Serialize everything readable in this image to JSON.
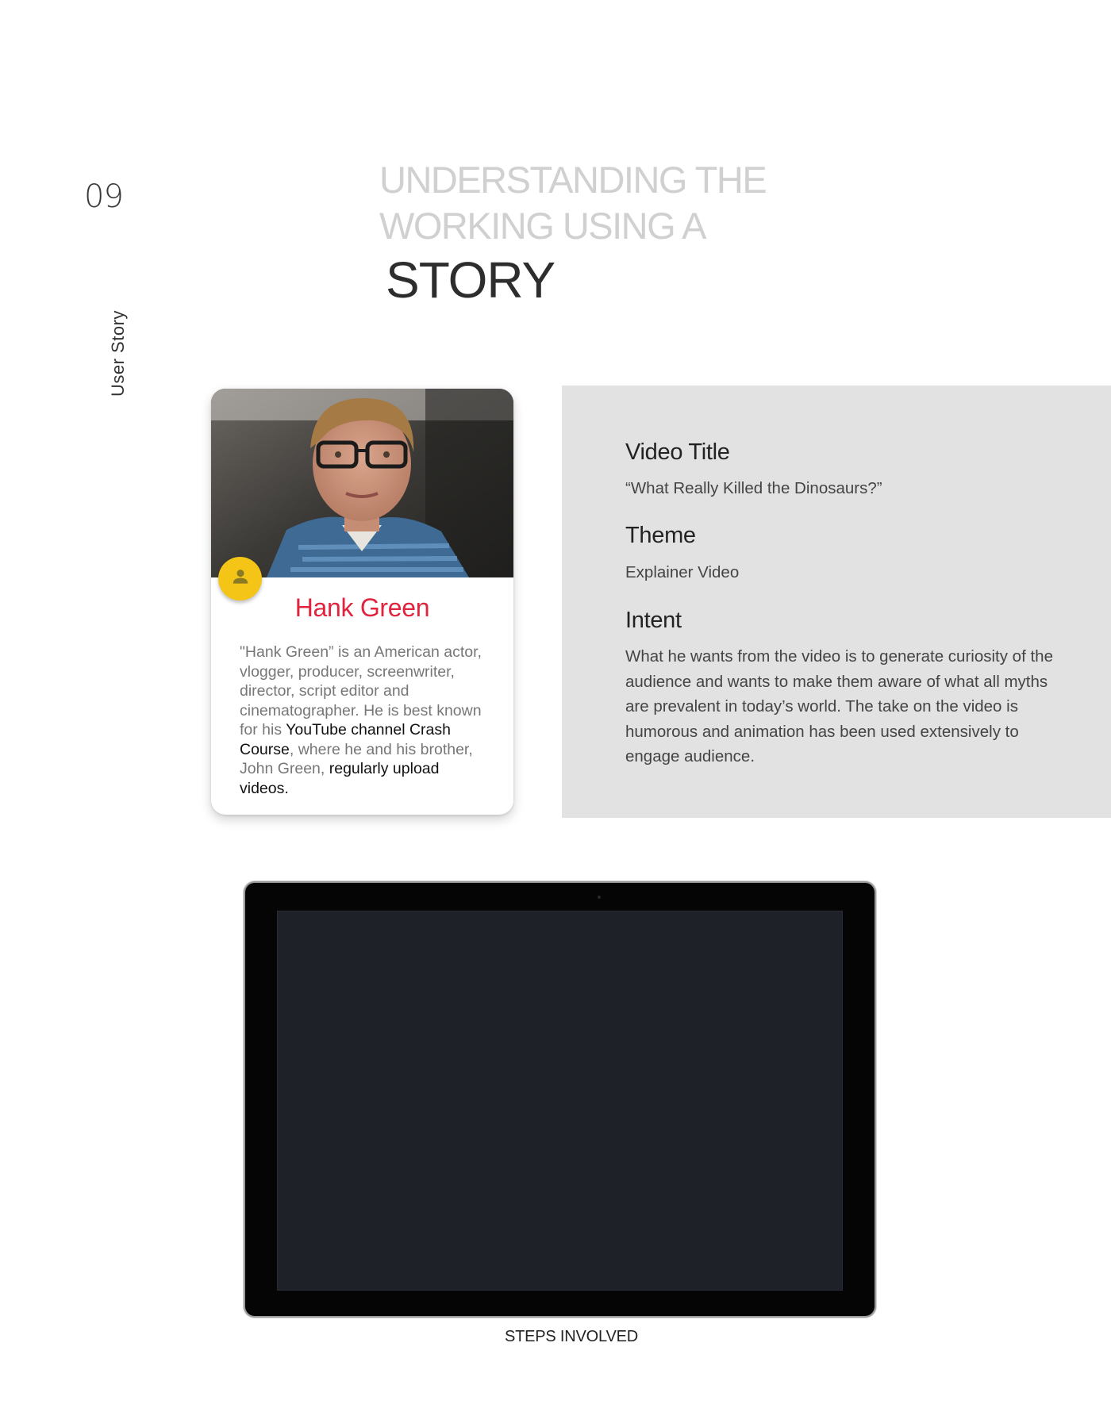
{
  "page": {
    "number": "09",
    "section_label": "User Story",
    "title_light": [
      "UNDERSTANDING THE",
      "WORKING USING A"
    ],
    "title_dark": "STORY"
  },
  "profile_card": {
    "name": "Hank Green",
    "avatar_icon": "person-icon",
    "avatar_color": "#f4c517",
    "name_color": "#e0243d",
    "bio_segments": [
      {
        "text": "\"Hank Green” is an American actor, vlogger, producer, screenwriter, director, script editor and cinematographer. He is best known for his ",
        "highlight": false
      },
      {
        "text": "YouTube channel Crash Course",
        "highlight": true
      },
      {
        "text": ", where he and his brother, John Green, ",
        "highlight": false
      },
      {
        "text": "regularly upload videos.",
        "highlight": true
      }
    ]
  },
  "info": {
    "video_title_heading": "Video Title",
    "video_title_value": "“What Really Killed the Dinosaurs?”",
    "theme_heading": "Theme",
    "theme_value": "Explainer Video",
    "intent_heading": "Intent",
    "intent_value": "What he wants from the video is to generate curiosity of the audience and wants to make them aware of what all myths are prevalent in today’s world. The take on the video is humorous and animation has been used extensively to engage audience."
  },
  "tablet": {
    "screen_color": "#1f2129"
  },
  "caption": "STEPS INVOLVED"
}
